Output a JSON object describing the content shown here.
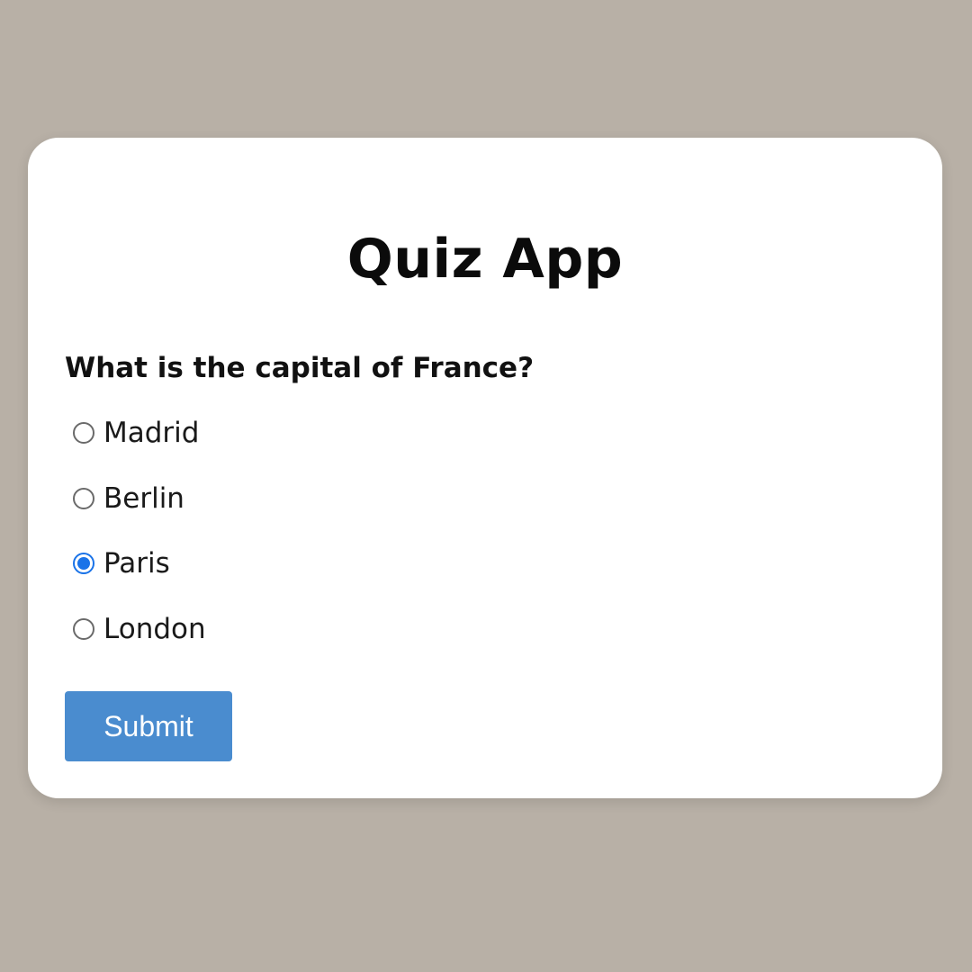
{
  "app": {
    "title": "Quiz App"
  },
  "quiz": {
    "question": "What is the capital of France?",
    "options": [
      {
        "label": "Madrid",
        "checked": false
      },
      {
        "label": "Berlin",
        "checked": false
      },
      {
        "label": "Paris",
        "checked": true
      },
      {
        "label": "London",
        "checked": false
      }
    ],
    "submit_label": "Submit"
  },
  "colors": {
    "background": "#b8b0a6",
    "card": "#ffffff",
    "accent": "#1a73e8",
    "button": "#4a8ccf"
  }
}
